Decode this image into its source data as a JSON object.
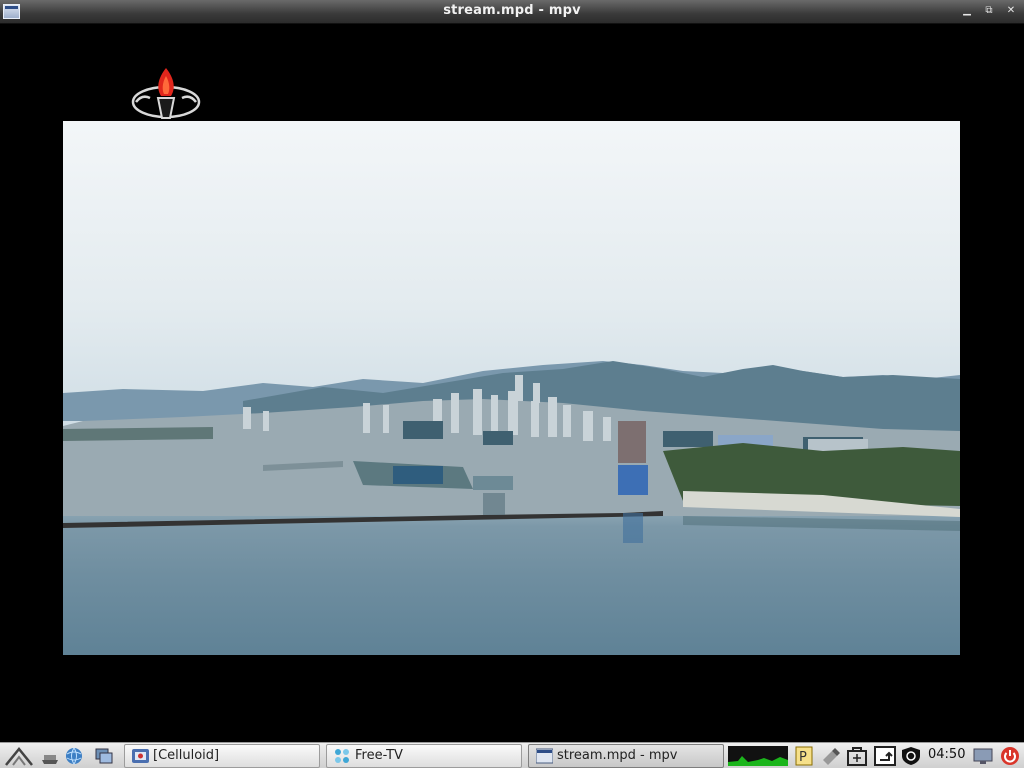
{
  "window": {
    "title": "stream.mpd - mpv",
    "controls": [
      "minimize-icon",
      "maximize-icon",
      "close-icon"
    ]
  },
  "video": {
    "channel_logo": "torch-emblem-logo"
  },
  "taskbar": {
    "launchers": [
      "start-menu-icon",
      "show-desktop-icon",
      "browser-globe-icon",
      "window-switcher-icon"
    ],
    "tasks": [
      {
        "label": "[Celluloid]",
        "icon": "celluloid-icon",
        "active": false
      },
      {
        "label": "Free-TV",
        "icon": "free-tv-icon",
        "active": false
      },
      {
        "label": "stream.mpd - mpv",
        "icon": "mpv-window-icon",
        "active": true
      }
    ],
    "tray": [
      "cpu-monitor-graph-icon",
      "p-indicator-icon",
      "clipboard-tool-icon",
      "bag-icon",
      "screen-rotate-icon",
      "shield-icon",
      "volume-icon",
      "power-icon"
    ],
    "clock": "04:50"
  }
}
